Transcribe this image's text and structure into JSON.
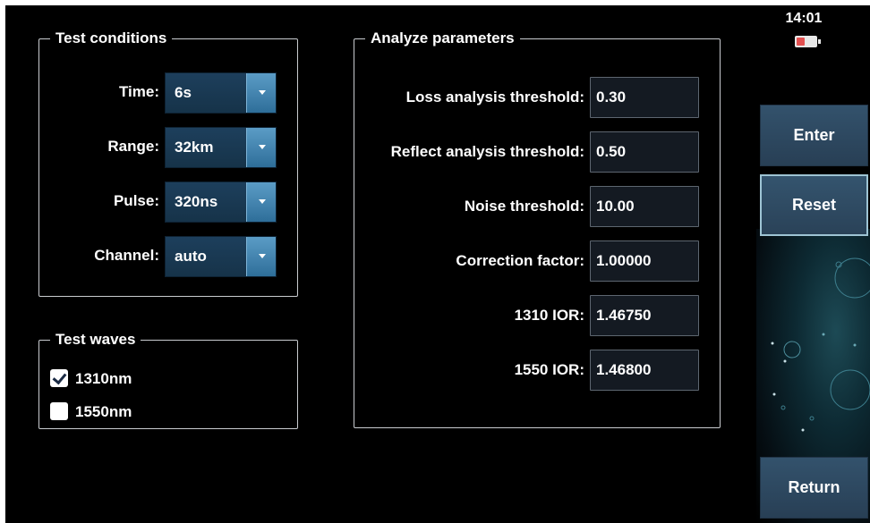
{
  "status": {
    "clock": "14:01",
    "battery_icon": "battery-low-icon",
    "battery_color": "#e25050"
  },
  "test_conditions": {
    "title": "Test conditions",
    "rows": [
      {
        "label": "Time:",
        "value": "6s"
      },
      {
        "label": "Range:",
        "value": "32km"
      },
      {
        "label": "Pulse:",
        "value": "320ns"
      },
      {
        "label": "Channel:",
        "value": "auto"
      }
    ]
  },
  "test_waves": {
    "title": "Test waves",
    "items": [
      {
        "label": "1310nm",
        "checked": true
      },
      {
        "label": "1550nm",
        "checked": false
      }
    ]
  },
  "analyze_parameters": {
    "title": "Analyze parameters",
    "rows": [
      {
        "label": "Loss analysis threshold:",
        "value": "0.30"
      },
      {
        "label": "Reflect analysis threshold:",
        "value": "0.50"
      },
      {
        "label": "Noise threshold:",
        "value": "10.00"
      },
      {
        "label": "Correction factor:",
        "value": "1.00000"
      },
      {
        "label": "1310 IOR:",
        "value": "1.46750"
      },
      {
        "label": "1550 IOR:",
        "value": "1.46800"
      }
    ]
  },
  "buttons": {
    "enter": "Enter",
    "reset": "Reset",
    "return": "Return"
  },
  "colors": {
    "accent_button": "#2f4b64",
    "combo_button": "#4a8ab5",
    "background": "#000000"
  }
}
